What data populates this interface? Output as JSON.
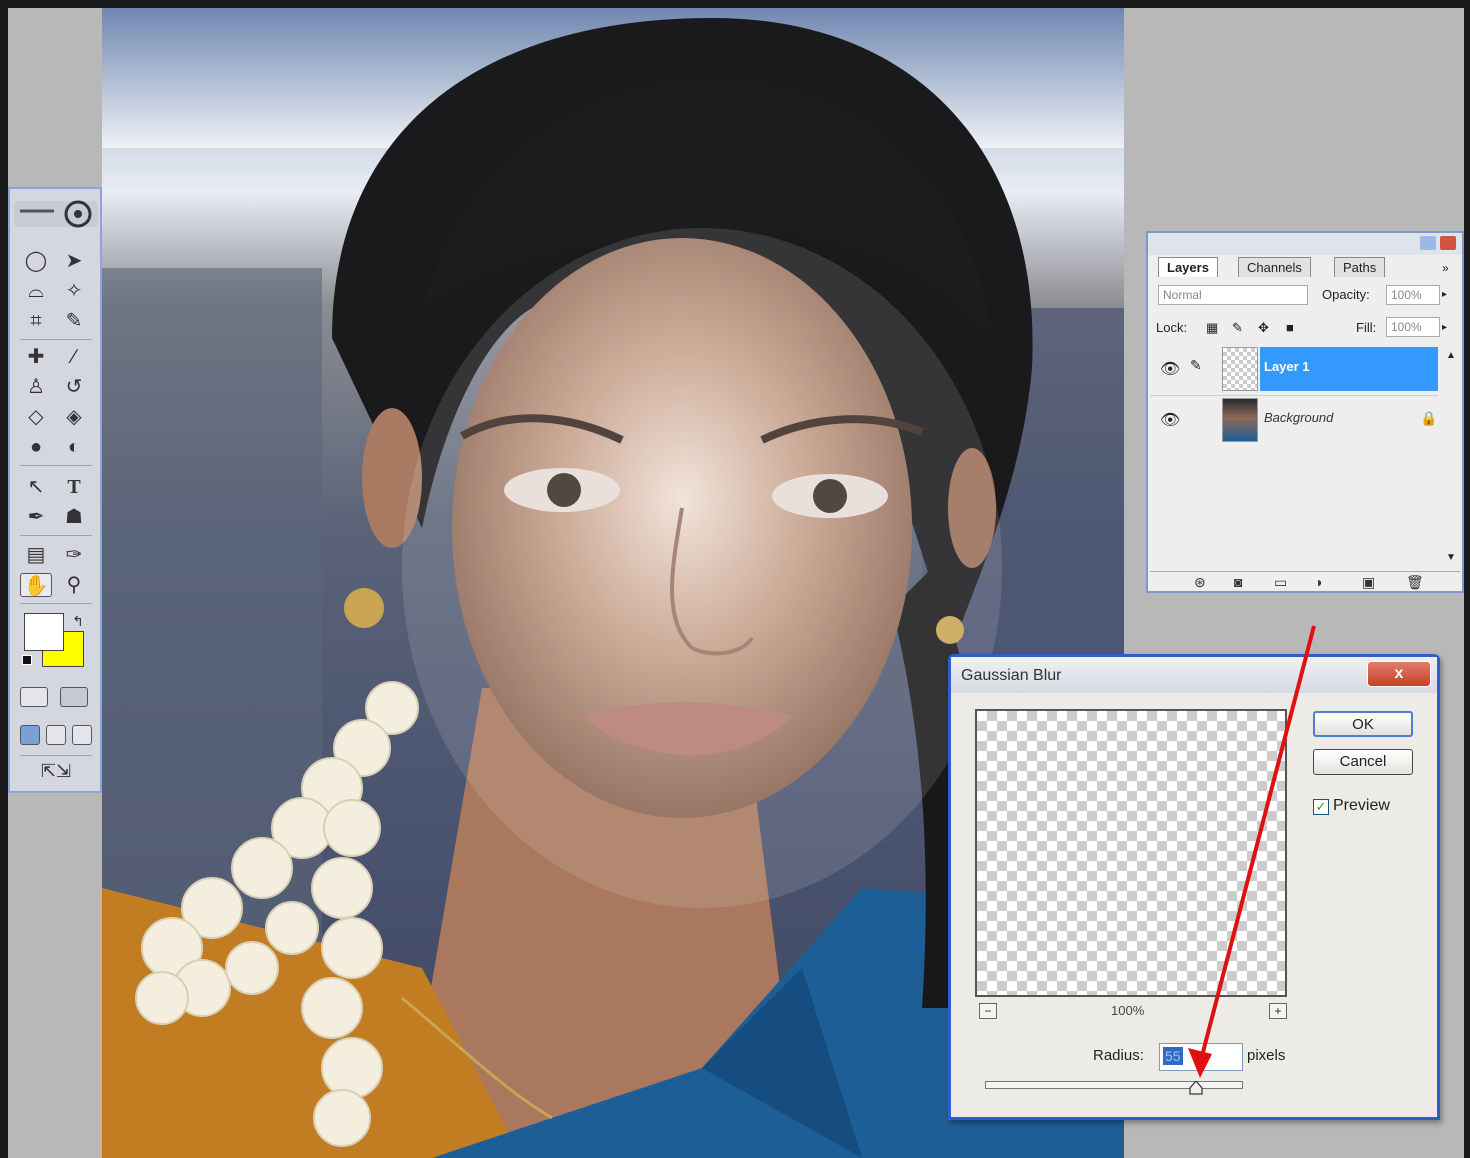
{
  "toolbox": {
    "tools": [
      "marquee-icon",
      "move-icon",
      "lasso-icon",
      "magic-wand-icon",
      "crop-icon",
      "slice-icon",
      "healing-brush-icon",
      "brush-icon",
      "clone-stamp-icon",
      "history-brush-icon",
      "eraser-icon",
      "paint-bucket-icon",
      "blur-icon",
      "dodge-icon",
      "path-select-icon",
      "type-icon",
      "pen-icon",
      "shape-icon",
      "notes-icon",
      "eyedropper-icon",
      "hand-icon",
      "zoom-icon"
    ],
    "type_tool_label": "T",
    "foreground_color": "#ffffff",
    "background_color": "#ffff00"
  },
  "layers_panel": {
    "tabs": [
      "Layers",
      "Channels",
      "Paths"
    ],
    "blend_mode": "Normal",
    "opacity_label": "Opacity:",
    "opacity_value": "100%",
    "lock_label": "Lock:",
    "fill_label": "Fill:",
    "fill_value": "100%",
    "layers": [
      {
        "name": "Layer 1",
        "selected": true
      },
      {
        "name": "Background",
        "selected": false
      }
    ],
    "highlight_color": "#3399ff"
  },
  "dialog": {
    "title": "Gaussian Blur",
    "close_label": "x",
    "ok_label": "OK",
    "cancel_label": "Cancel",
    "preview_label": "Preview",
    "preview_checked": true,
    "zoom_value": "100%",
    "zoom_out_label": "−",
    "zoom_in_label": "+",
    "radius_label": "Radius:",
    "radius_value": "55",
    "radius_unit": "pixels"
  },
  "annotation": {
    "arrow_color": "#e01010"
  }
}
